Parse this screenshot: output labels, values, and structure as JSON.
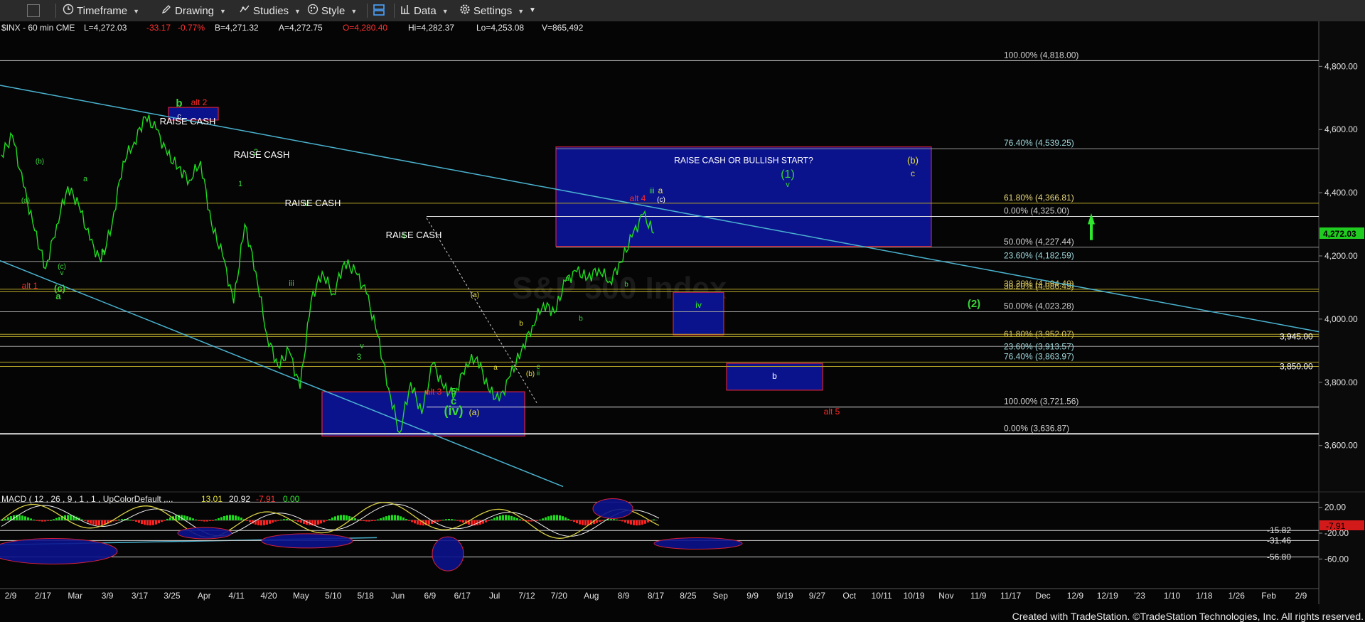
{
  "toolbar": {
    "timeframe": "Timeframe",
    "drawing": "Drawing",
    "studies": "Studies",
    "style": "Style",
    "data": "Data",
    "settings": "Settings"
  },
  "footer": {
    "credit": "Created with TradeStation. ©TradeStation Technologies, Inc. All rights reserved."
  },
  "colors": {
    "price": "#1fdc1f",
    "green_label": "#39d739",
    "red_label": "#ff2a2a",
    "yellow_label": "#e8e23a",
    "white_label": "#ffffff",
    "box_fill": "#0b138c",
    "box_border": "#d4213a",
    "trendline": "#4ab3d0",
    "fib_line": "#e6e6e6",
    "fib_gold": "#b5a52a",
    "macd_fast": "#d8cf45",
    "macd_slow": "#f0f0f0",
    "hist_up": "#1fdc1f",
    "hist_down": "#ff2020",
    "current_price_bg": "#1fcc1f"
  },
  "chart_data": {
    "type": "line",
    "symbol_header": "$INX - 60 min  CME",
    "quote": {
      "last": "L=4,272.03",
      "change": "-33.17",
      "pct": "-0.77%",
      "bid": "B=4,271.32",
      "ask": "A=4,272.75",
      "open": "O=4,280.40",
      "high": "Hi=4,282.37",
      "low": "Lo=4,253.08",
      "volume": "V=865,492"
    },
    "watermark": "S&P 500 Index",
    "ylim": [
      3480,
      4920
    ],
    "y_ticks": [
      3600,
      3800,
      4000,
      4200,
      4400,
      4600,
      4800
    ],
    "y_tick_labels": [
      "3,600.00",
      "3,800.00",
      "4,000.00",
      "4,200.00",
      "4,400.00",
      "4,600.00",
      "4,800.00"
    ],
    "current_price": {
      "value": 4272.03,
      "label": "4,272.03"
    },
    "x_labels": [
      "2/9",
      "2/17",
      "Mar",
      "3/9",
      "3/17",
      "3/25",
      "Apr",
      "4/11",
      "4/20",
      "May",
      "5/10",
      "5/18",
      "Jun",
      "6/9",
      "6/17",
      "Jul",
      "7/12",
      "7/20",
      "Aug",
      "8/9",
      "8/17",
      "8/25",
      "Sep",
      "9/9",
      "9/19",
      "9/27",
      "Oct",
      "10/11",
      "10/19",
      "Nov",
      "11/9",
      "11/17",
      "Dec",
      "12/9",
      "12/19",
      "'23",
      "1/10",
      "1/18",
      "1/26",
      "Feb",
      "2/9"
    ],
    "price_path": [
      [
        0,
        4520
      ],
      [
        1,
        4580
      ],
      [
        2,
        4420
      ],
      [
        3,
        4280
      ],
      [
        4,
        4160
      ],
      [
        5,
        4300
      ],
      [
        6,
        4420
      ],
      [
        7,
        4360
      ],
      [
        8,
        4250
      ],
      [
        9,
        4180
      ],
      [
        10,
        4300
      ],
      [
        11,
        4500
      ],
      [
        12,
        4560
      ],
      [
        13,
        4640
      ],
      [
        14,
        4600
      ],
      [
        15,
        4520
      ],
      [
        16,
        4480
      ],
      [
        17,
        4440
      ],
      [
        18,
        4500
      ],
      [
        19,
        4300
      ],
      [
        20,
        4200
      ],
      [
        21,
        4050
      ],
      [
        22,
        4300
      ],
      [
        23,
        4150
      ],
      [
        24,
        3950
      ],
      [
        25,
        3850
      ],
      [
        26,
        3900
      ],
      [
        27,
        3780
      ],
      [
        28,
        4060
      ],
      [
        29,
        4150
      ],
      [
        30,
        4080
      ],
      [
        31,
        4180
      ],
      [
        32,
        4150
      ],
      [
        33,
        4080
      ],
      [
        34,
        3950
      ],
      [
        35,
        3780
      ],
      [
        36,
        3640
      ],
      [
        37,
        3800
      ],
      [
        38,
        3700
      ],
      [
        39,
        3860
      ],
      [
        40,
        3780
      ],
      [
        41,
        3760
      ],
      [
        42,
        3860
      ],
      [
        43,
        3880
      ],
      [
        44,
        3780
      ],
      [
        45,
        3740
      ],
      [
        46,
        3820
      ],
      [
        47,
        3900
      ],
      [
        48,
        3980
      ],
      [
        49,
        4050
      ],
      [
        50,
        4020
      ],
      [
        51,
        4120
      ],
      [
        52,
        4150
      ],
      [
        53,
        4130
      ],
      [
        54,
        4160
      ],
      [
        55,
        4120
      ],
      [
        56,
        4180
      ],
      [
        57,
        4260
      ],
      [
        58,
        4330
      ],
      [
        59,
        4272
      ]
    ],
    "fib_levels": [
      {
        "label": "100.00% (4,818.00)",
        "value": 4818
      },
      {
        "label": "76.40% (4,539.25)",
        "value": 4539.25
      },
      {
        "label": "61.80% (4,366.81)",
        "value": 4366.81
      },
      {
        "label": "0.00% (4,325.00)",
        "value": 4325
      },
      {
        "label": "50.00% (4,227.44)",
        "value": 4227.44
      },
      {
        "label": "23.60% (4,182.59)",
        "value": 4182.59
      },
      {
        "label": "38.20% (4,094.40)",
        "value": 4094.4
      },
      {
        "label": "38.20% (4,086.49)",
        "value": 4086.49
      },
      {
        "label": "50.00% (4,023.28)",
        "value": 4023.28
      },
      {
        "label": "61.80% (3,952.07)",
        "value": 3952.07
      },
      {
        "label": "3,945.00",
        "value": 3945
      },
      {
        "label": "23.60% (3,913.57)",
        "value": 3913.57
      },
      {
        "label": "76.40% (3,863.97)",
        "value": 3863.97
      },
      {
        "label": "3,850.00",
        "value": 3850
      },
      {
        "label": "100.00% (3,721.56)",
        "value": 3721.56
      },
      {
        "label": "0.00% (3,636.87)",
        "value": 3636.87
      }
    ],
    "boxes": [
      {
        "label": "RAISE CASH OR BULLISH START?",
        "y_top": 4545,
        "y_bottom": 4230
      },
      {
        "label": "iv",
        "y_top": 4085,
        "y_bottom": 3950
      },
      {
        "label": "b",
        "y_top": 3860,
        "y_bottom": 3775
      },
      {
        "label": "",
        "y_top": 3770,
        "y_bottom": 3630
      },
      {
        "label": "",
        "y_top": 3770,
        "y_bottom": 3630
      },
      {
        "label": "",
        "y_top": 4670,
        "y_bottom": 4630
      }
    ],
    "annotations": [
      {
        "text": "b",
        "color": "green"
      },
      {
        "text": "alt 2",
        "color": "red"
      },
      {
        "text": "c",
        "color": "white"
      },
      {
        "text": "RAISE CASH",
        "color": "white"
      },
      {
        "text": "2",
        "color": "green"
      },
      {
        "text": "RAISE CASH",
        "color": "white"
      },
      {
        "text": "1",
        "color": "green"
      },
      {
        "text": "iv",
        "color": "green"
      },
      {
        "text": "RAISE CASH",
        "color": "white"
      },
      {
        "text": "iii",
        "color": "green"
      },
      {
        "text": "4",
        "color": "green"
      },
      {
        "text": "RAISE CASH",
        "color": "white"
      },
      {
        "text": "v",
        "color": "green"
      },
      {
        "text": "3",
        "color": "green"
      },
      {
        "text": "(b)",
        "color": "green"
      },
      {
        "text": "(a)",
        "color": "green"
      },
      {
        "text": "a",
        "color": "green"
      },
      {
        "text": "b",
        "color": "green"
      },
      {
        "text": "(c)",
        "color": "green"
      },
      {
        "text": "v",
        "color": "green"
      },
      {
        "text": "(c)",
        "color": "green"
      },
      {
        "text": "a",
        "color": "green"
      },
      {
        "text": "alt 1",
        "color": "red"
      },
      {
        "text": "(a)",
        "color": "yellow"
      },
      {
        "text": "a",
        "color": "yellow"
      },
      {
        "text": "b",
        "color": "yellow"
      },
      {
        "text": "(b)",
        "color": "yellow"
      },
      {
        "text": "c",
        "color": "green"
      },
      {
        "text": "ii",
        "color": "green"
      },
      {
        "text": "alt 3",
        "color": "red"
      },
      {
        "text": "5",
        "color": "green"
      },
      {
        "text": "c",
        "color": "green"
      },
      {
        "text": "(iv)",
        "color": "green"
      },
      {
        "text": "(a)",
        "color": "yellow"
      },
      {
        "text": "a",
        "color": "green"
      },
      {
        "text": "b",
        "color": "green"
      },
      {
        "text": "alt 4",
        "color": "red"
      },
      {
        "text": "iii",
        "color": "green"
      },
      {
        "text": "a",
        "color": "yellow"
      },
      {
        "text": "(c)",
        "color": "white"
      },
      {
        "text": "b",
        "color": "green"
      },
      {
        "text": "(1)",
        "color": "green"
      },
      {
        "text": "v",
        "color": "green"
      },
      {
        "text": "(b)",
        "color": "yellow"
      },
      {
        "text": "c",
        "color": "yellow"
      },
      {
        "text": "(2)",
        "color": "green"
      },
      {
        "text": "alt 5",
        "color": "red"
      }
    ],
    "macd": {
      "header": "MACD ( 12 , 26 , 9 , 1 , 1 , UpColorDefault ,...",
      "values": [
        "13.01",
        "20.92",
        "-7.91",
        "0.00"
      ],
      "ylim": [
        -75,
        35
      ],
      "y_ticks": [
        20,
        -20,
        -60
      ],
      "y_tick_labels": [
        "20.00",
        "-20.00",
        "-60.00"
      ],
      "levels": [
        {
          "label": "-15.82",
          "value": -15.82
        },
        {
          "label": "-31.46",
          "value": -31.46
        },
        {
          "label": "-56.80",
          "value": -56.8
        }
      ],
      "current": {
        "label": "-7.91",
        "value": -7.91
      }
    }
  }
}
